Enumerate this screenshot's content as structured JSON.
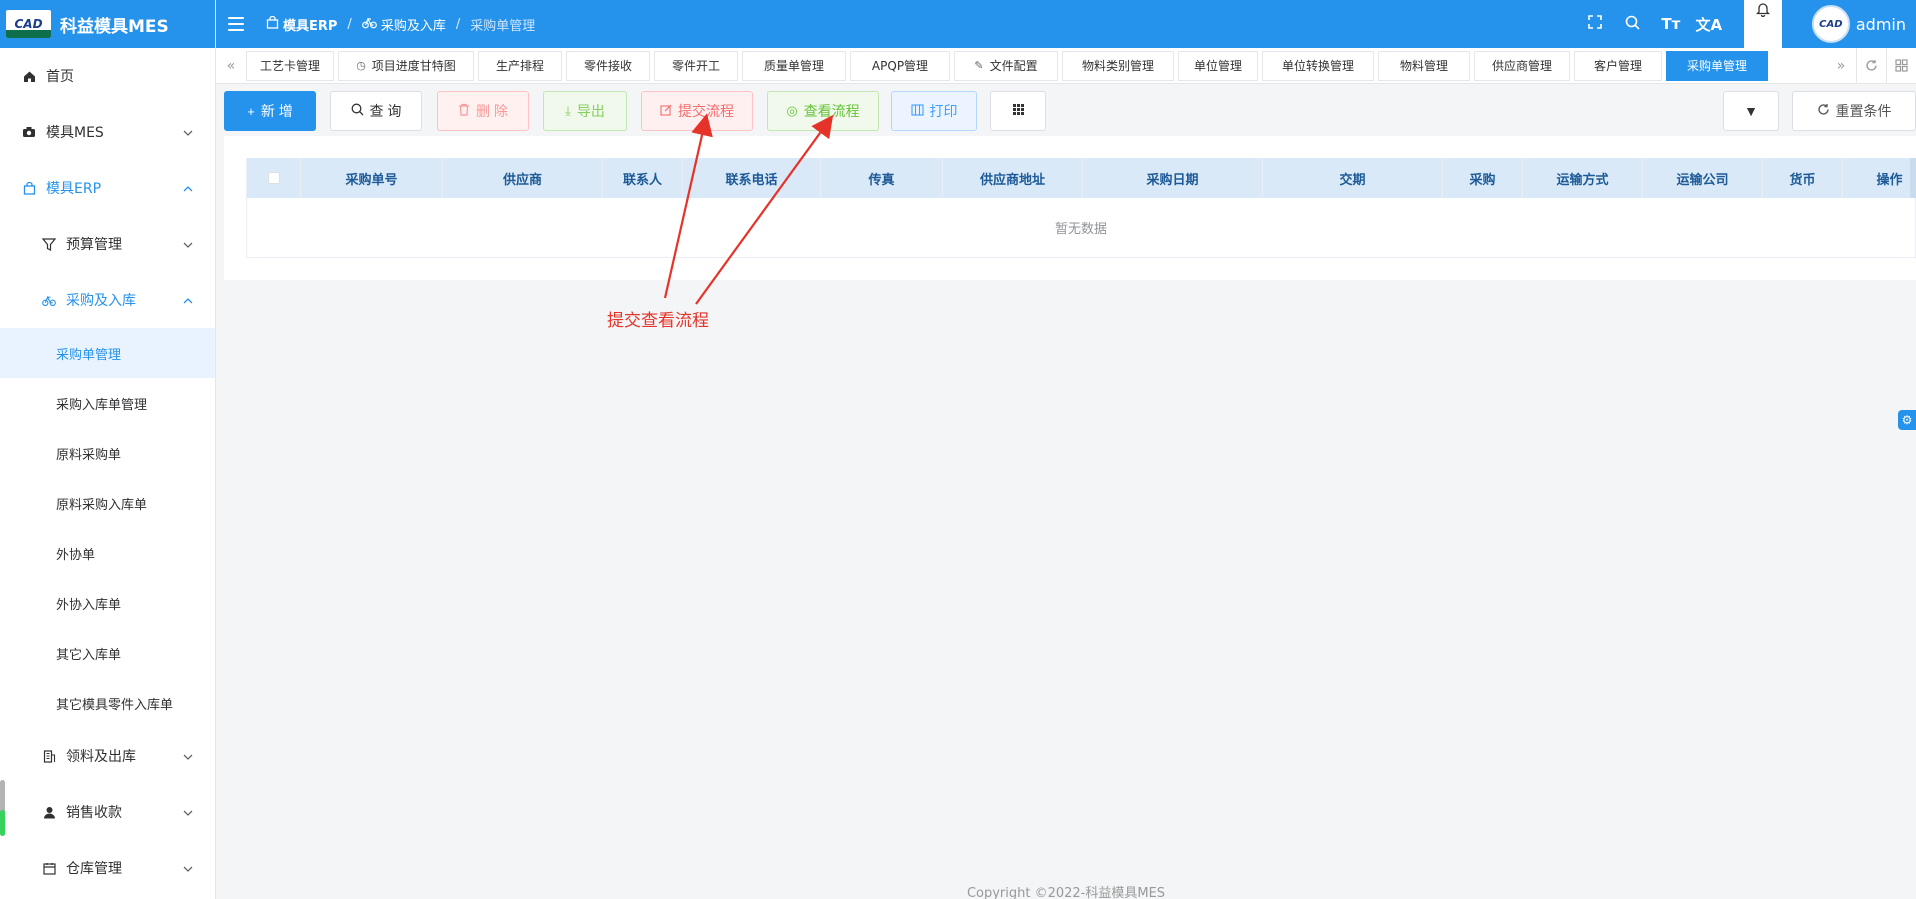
{
  "brand": {
    "logo_text": "CAD",
    "title": "科益模具MES"
  },
  "sidebar": {
    "items": [
      {
        "label": "首页",
        "icon": "home-icon",
        "level": 0
      },
      {
        "label": "模具MES",
        "icon": "camera-icon",
        "level": 0,
        "expanded": false
      },
      {
        "label": "模具ERP",
        "icon": "bag-icon",
        "level": 0,
        "expanded": true
      },
      {
        "label": "预算管理",
        "icon": "filter-icon",
        "level": 1,
        "expanded": false
      },
      {
        "label": "采购及入库",
        "icon": "bicycle-icon",
        "level": 1,
        "expanded": true
      },
      {
        "label": "采购单管理",
        "level": 2,
        "selected": true
      },
      {
        "label": "采购入库单管理",
        "level": 2
      },
      {
        "label": "原料采购单",
        "level": 2
      },
      {
        "label": "原料采购入库单",
        "level": 2
      },
      {
        "label": "外协单",
        "level": 2
      },
      {
        "label": "外协入库单",
        "level": 2
      },
      {
        "label": "其它入库单",
        "level": 2
      },
      {
        "label": "其它模具零件入库单",
        "level": 2
      },
      {
        "label": "领料及出库",
        "icon": "building-icon",
        "level": 1,
        "expanded": false
      },
      {
        "label": "销售收款",
        "icon": "user-icon",
        "level": 1,
        "expanded": false
      },
      {
        "label": "仓库管理",
        "icon": "calendar-icon",
        "level": 1,
        "expanded": false
      }
    ]
  },
  "header": {
    "breadcrumb": [
      {
        "label": "模具ERP",
        "icon": "bag-icon"
      },
      {
        "label": "采购及入库",
        "icon": "bicycle-icon"
      },
      {
        "label": "采购单管理"
      }
    ],
    "username": "admin"
  },
  "tabs": [
    {
      "label": "工艺卡管理",
      "w": 88
    },
    {
      "label": "项目进度甘特图",
      "w": 136,
      "icon": "clock-icon"
    },
    {
      "label": "生产排程",
      "w": 84
    },
    {
      "label": "零件接收",
      "w": 84
    },
    {
      "label": "零件开工",
      "w": 84
    },
    {
      "label": "质量单管理",
      "w": 104
    },
    {
      "label": "APQP管理",
      "w": 100
    },
    {
      "label": "文件配置",
      "w": 104,
      "icon": "edit-icon"
    },
    {
      "label": "物料类别管理",
      "w": 112
    },
    {
      "label": "单位管理",
      "w": 80
    },
    {
      "label": "单位转换管理",
      "w": 112
    },
    {
      "label": "物料管理",
      "w": 92
    },
    {
      "label": "供应商管理",
      "w": 96
    },
    {
      "label": "客户管理",
      "w": 88
    },
    {
      "label": "采购单管理",
      "w": 102,
      "active": true
    }
  ],
  "toolbar": {
    "add": "新 增",
    "query": "查 询",
    "delete": "删 除",
    "export": "导出",
    "submit_flow": "提交流程",
    "view_flow": "查看流程",
    "print": "打印",
    "reset": "重置条件"
  },
  "table": {
    "columns": [
      {
        "label": "",
        "w": 54,
        "checkbox": true
      },
      {
        "label": "采购单号",
        "w": 142
      },
      {
        "label": "供应商",
        "w": 160
      },
      {
        "label": "联系人",
        "w": 80
      },
      {
        "label": "联系电话",
        "w": 138
      },
      {
        "label": "传真",
        "w": 122
      },
      {
        "label": "供应商地址",
        "w": 140
      },
      {
        "label": "采购日期",
        "w": 180
      },
      {
        "label": "交期",
        "w": 180
      },
      {
        "label": "采购",
        "w": 80
      },
      {
        "label": "运输方式",
        "w": 120
      },
      {
        "label": "运输公司",
        "w": 120
      },
      {
        "label": "货币",
        "w": 80
      },
      {
        "label": "操作",
        "w": 94
      }
    ],
    "empty_text": "暂无数据"
  },
  "annotation": {
    "text": "提交查看流程",
    "color": "#e5332a"
  },
  "footer": {
    "copyright": "Copyright ©2022-科益模具MES"
  },
  "colors": {
    "primary": "#2592ec",
    "selected_bg": "#e8f3ff",
    "header_row": "#d9e9f8"
  }
}
